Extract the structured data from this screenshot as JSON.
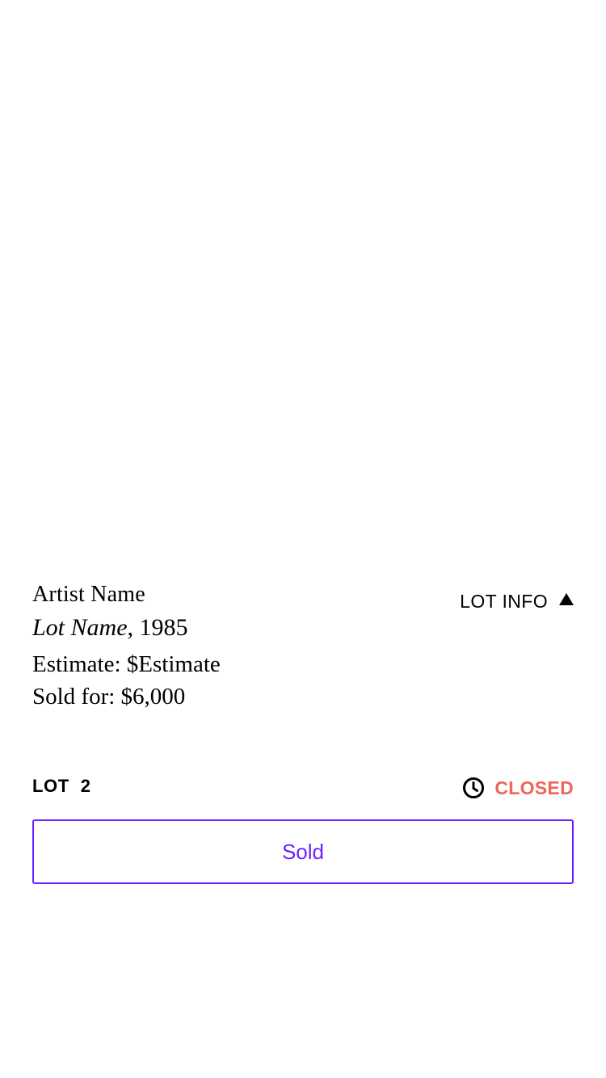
{
  "lot": {
    "artist_name": "Artist Name",
    "lot_name": "Lot Name",
    "year_suffix": ", 1985",
    "estimate": "Estimate: $Estimate",
    "sold_for": "Sold for: $6,000"
  },
  "lot_info_toggle": {
    "label": "LOT INFO",
    "icon": "triangle-up-icon"
  },
  "lot_number": {
    "label": "LOT",
    "value": "2"
  },
  "status": {
    "icon": "clock-icon",
    "text": "CLOSED",
    "color": "#f0645a"
  },
  "action_button": {
    "label": "Sold",
    "color": "#6e1fff"
  }
}
